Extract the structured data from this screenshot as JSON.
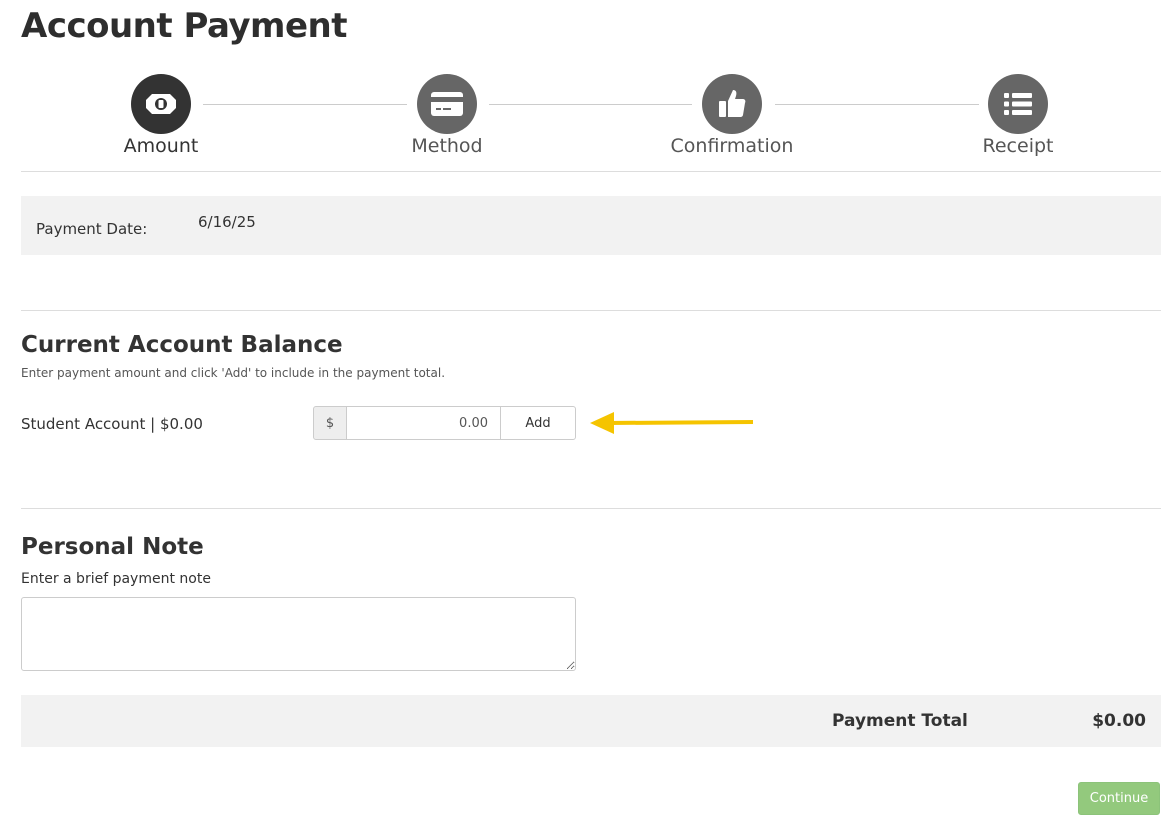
{
  "page": {
    "title": "Account Payment"
  },
  "steps": [
    {
      "label": "Amount",
      "icon": "money-icon",
      "active": true
    },
    {
      "label": "Method",
      "icon": "credit-card-icon",
      "active": false
    },
    {
      "label": "Confirmation",
      "icon": "thumbs-up-icon",
      "active": false
    },
    {
      "label": "Receipt",
      "icon": "list-icon",
      "active": false
    }
  ],
  "payment_date": {
    "label": "Payment Date:",
    "value": "6/16/25"
  },
  "balance": {
    "title": "Current Account Balance",
    "help": "Enter payment amount and click 'Add' to include in the payment total.",
    "account_label": "Student Account | $0.00",
    "currency_symbol": "$",
    "amount_value": "0.00",
    "add_label": "Add"
  },
  "note": {
    "title": "Personal Note",
    "help": "Enter a brief payment note",
    "value": ""
  },
  "total": {
    "label": "Payment Total",
    "value": "$0.00"
  },
  "actions": {
    "continue_label": "Continue"
  },
  "colors": {
    "accent_arrow": "#f5c400",
    "continue_bg": "#93c97d",
    "active_step": "#333333",
    "inactive_step": "#666666"
  }
}
